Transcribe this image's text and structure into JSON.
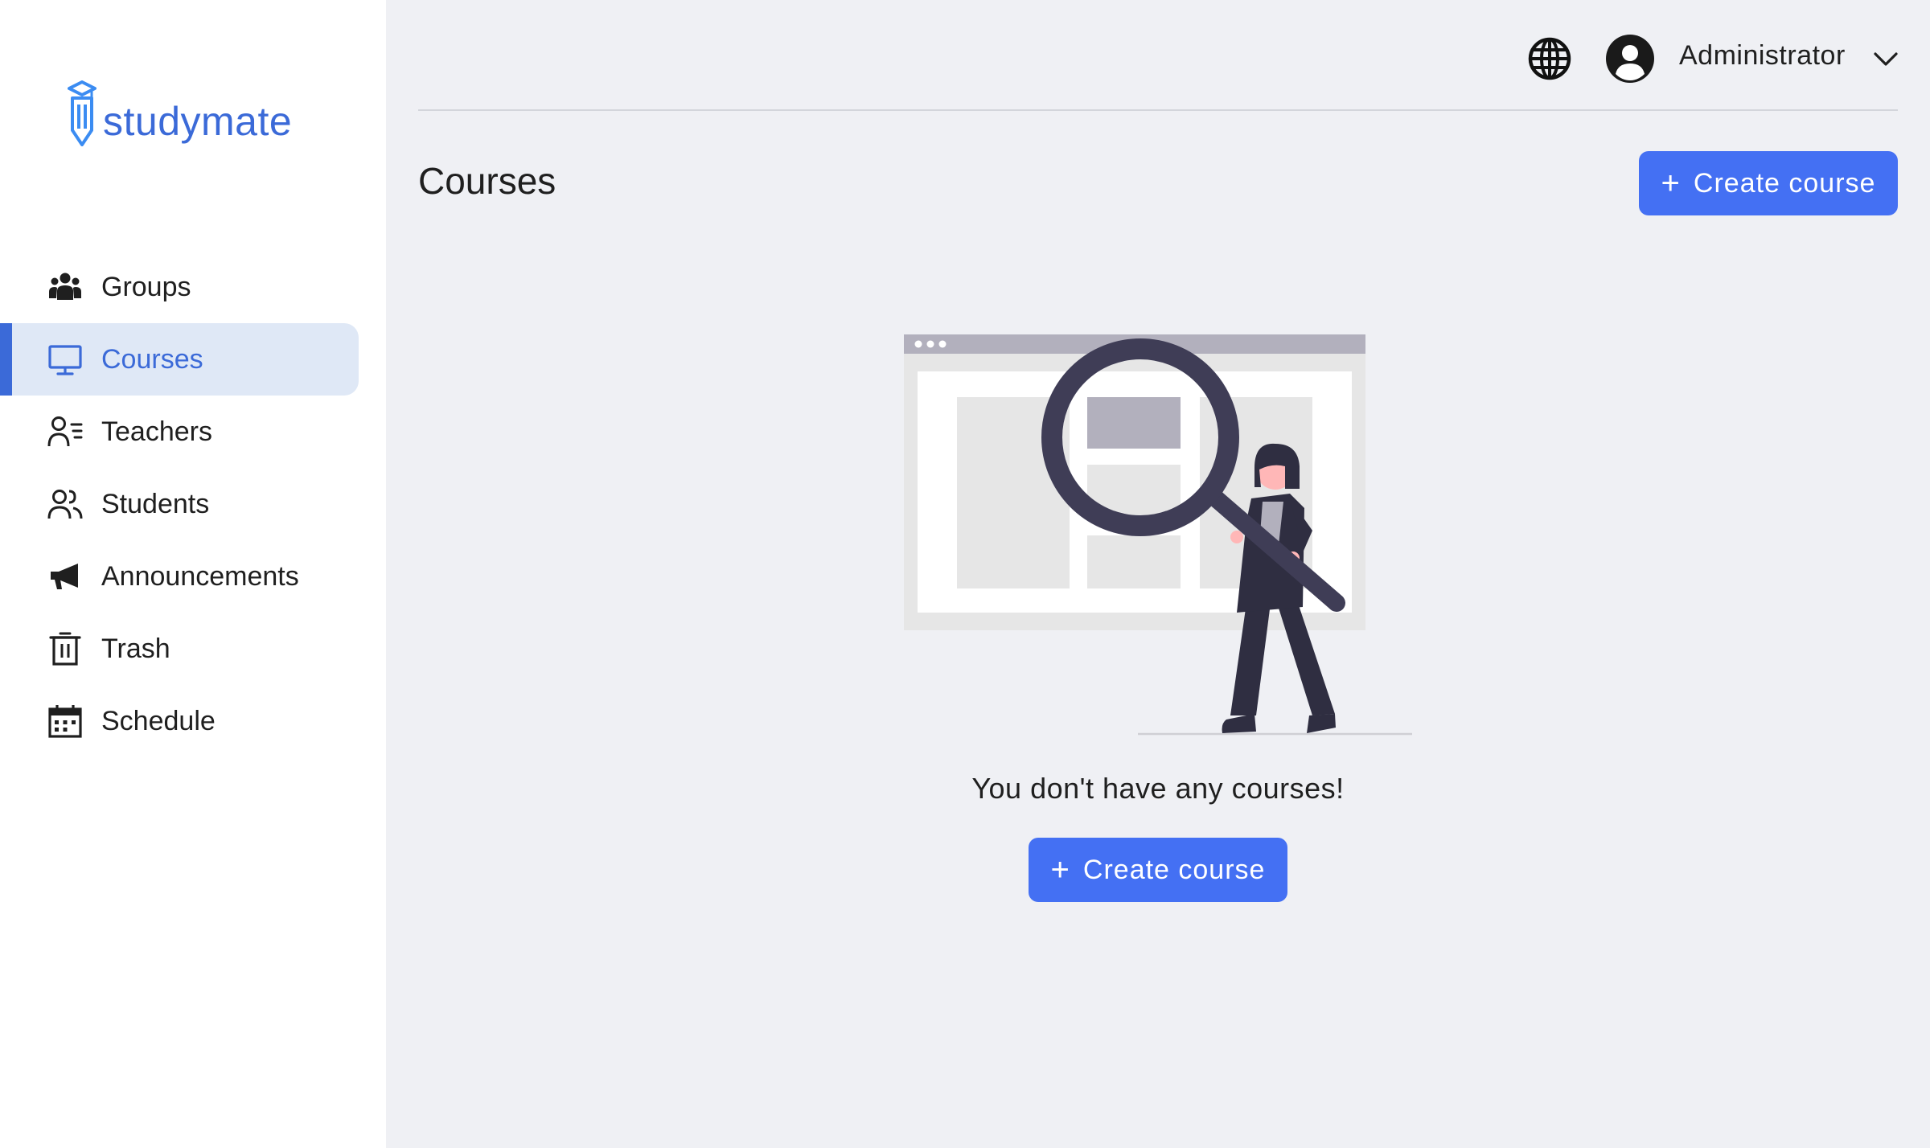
{
  "brand": {
    "name": "studymate",
    "color": "#3b6ad8"
  },
  "sidebar": {
    "items": [
      {
        "label": "Groups",
        "icon": "groups-icon",
        "active": false
      },
      {
        "label": "Courses",
        "icon": "monitor-icon",
        "active": true
      },
      {
        "label": "Teachers",
        "icon": "teacher-icon",
        "active": false
      },
      {
        "label": "Students",
        "icon": "students-icon",
        "active": false
      },
      {
        "label": "Announcements",
        "icon": "megaphone-icon",
        "active": false
      },
      {
        "label": "Trash",
        "icon": "trash-icon",
        "active": false
      },
      {
        "label": "Schedule",
        "icon": "calendar-icon",
        "active": false
      }
    ]
  },
  "header": {
    "language_icon": "globe-icon",
    "user": {
      "name": "Administrator",
      "avatar": "avatar-icon",
      "menu_icon": "chevron-down-icon"
    }
  },
  "main": {
    "title": "Courses",
    "create_button": {
      "label": "Create course",
      "icon": "plus-icon"
    },
    "empty_state": {
      "message": "You don't have any courses!",
      "button_label": "Create course",
      "illustration": "search-illustration"
    }
  },
  "colors": {
    "accent": "#4470f3",
    "active_bg": "#dfe8f6",
    "page_bg": "#eff0f4"
  }
}
